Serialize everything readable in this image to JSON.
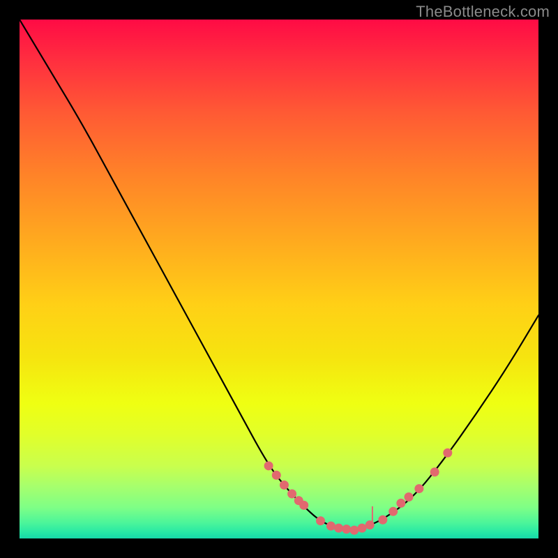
{
  "attribution": "TheBottleneck.com",
  "chart_data": {
    "type": "line",
    "title": "",
    "xlabel": "",
    "ylabel": "",
    "xlim": [
      0,
      100
    ],
    "ylim": [
      0,
      100
    ],
    "grid": false,
    "legend": null,
    "curve": {
      "name": "bottleneck-curve",
      "x": [
        0,
        6,
        12,
        18,
        24,
        30,
        36,
        42,
        48,
        52,
        56,
        58,
        60,
        62,
        64,
        66,
        70,
        76,
        82,
        88,
        94,
        100
      ],
      "y": [
        100,
        90,
        80,
        69,
        58,
        47,
        36,
        25,
        14,
        9,
        5,
        3.4,
        2.4,
        1.8,
        1.6,
        2.0,
        3.6,
        8,
        15.5,
        24,
        33,
        43
      ]
    },
    "markers": {
      "name": "highlight-points",
      "x": [
        48,
        49.5,
        51,
        52.5,
        53.8,
        54.8,
        58,
        60,
        61.5,
        63,
        64.5,
        66,
        67.5,
        70,
        72,
        73.5,
        75,
        77,
        80,
        82.5
      ],
      "y": [
        14,
        12.2,
        10.3,
        8.6,
        7.3,
        6.4,
        3.4,
        2.4,
        2.0,
        1.8,
        1.6,
        2.0,
        2.6,
        3.6,
        5.2,
        6.8,
        8.0,
        9.6,
        12.8,
        16.5
      ]
    },
    "tick": {
      "x": 68,
      "y0": 2.6,
      "y1": 6.2
    },
    "gradient_stops": [
      {
        "pos": 0,
        "color": "#ff0b45"
      },
      {
        "pos": 8,
        "color": "#ff2f3f"
      },
      {
        "pos": 18,
        "color": "#ff5a34"
      },
      {
        "pos": 30,
        "color": "#ff8328"
      },
      {
        "pos": 42,
        "color": "#ffa81f"
      },
      {
        "pos": 55,
        "color": "#ffd016"
      },
      {
        "pos": 65,
        "color": "#f6e40f"
      },
      {
        "pos": 74,
        "color": "#efff12"
      },
      {
        "pos": 80,
        "color": "#e1ff2a"
      },
      {
        "pos": 86,
        "color": "#c9ff4d"
      },
      {
        "pos": 90,
        "color": "#a6ff6d"
      },
      {
        "pos": 94,
        "color": "#7fff86"
      },
      {
        "pos": 97,
        "color": "#4bf59a"
      },
      {
        "pos": 99,
        "color": "#23e7a6"
      },
      {
        "pos": 100,
        "color": "#17d8a8"
      }
    ],
    "colors": {
      "curve": "#000000",
      "markers": "#e1696f",
      "background_top": "#ff0b45",
      "background_bottom": "#17d8a8",
      "frame": "#000000"
    }
  }
}
